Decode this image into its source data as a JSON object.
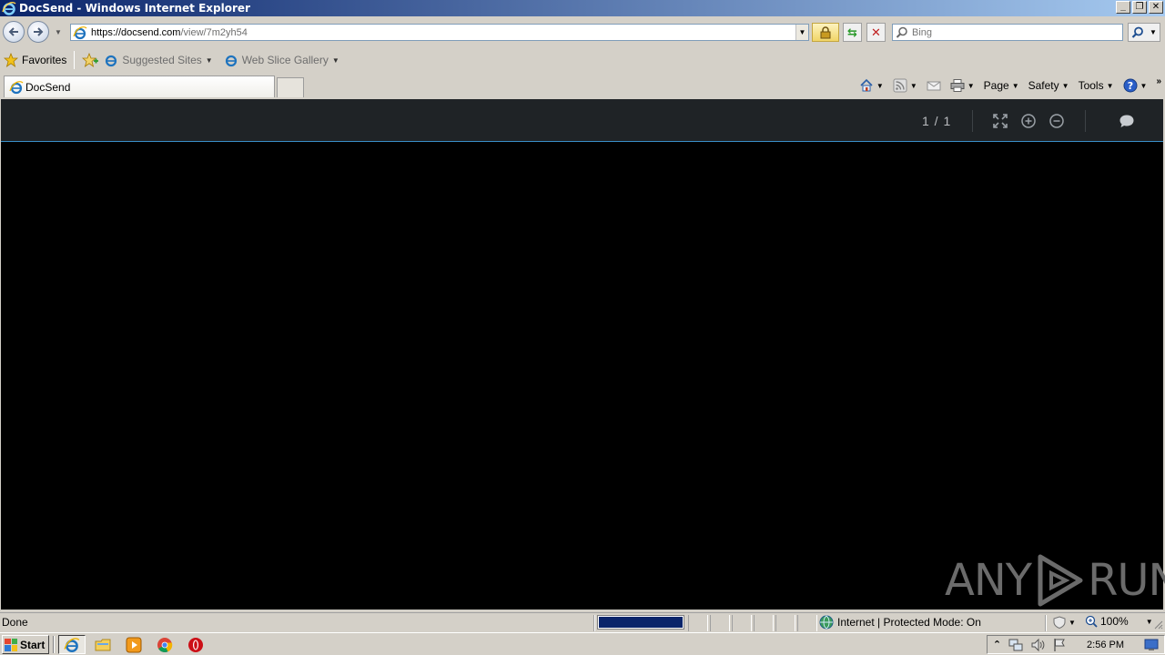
{
  "window": {
    "title": "DocSend - Windows Internet Explorer",
    "minimize": "_",
    "maximize": "❐",
    "close": "✕"
  },
  "address": {
    "url_host": "https://docsend.com",
    "url_path": "/view/7m2yh54"
  },
  "search": {
    "placeholder": "Bing"
  },
  "favorites": {
    "label": "Favorites",
    "items": [
      {
        "label": "Suggested Sites"
      },
      {
        "label": "Web Slice Gallery"
      }
    ]
  },
  "tabs": [
    {
      "label": "DocSend"
    }
  ],
  "commandbar": {
    "page": "Page",
    "safety": "Safety",
    "tools": "Tools"
  },
  "viewer": {
    "pager": "1 / 1"
  },
  "watermark": {
    "left": "ANY",
    "right": "RUN"
  },
  "status": {
    "text": "Done",
    "zone": "Internet | Protected Mode: On",
    "zoom": "100%",
    "progress": 1.0
  },
  "taskbar": {
    "start": "Start",
    "clock": "2:56 PM"
  },
  "colors": {
    "viewer_toolbar": "#1f2326",
    "viewer_accent": "#3a8fc8",
    "progress": "#0a246a"
  }
}
